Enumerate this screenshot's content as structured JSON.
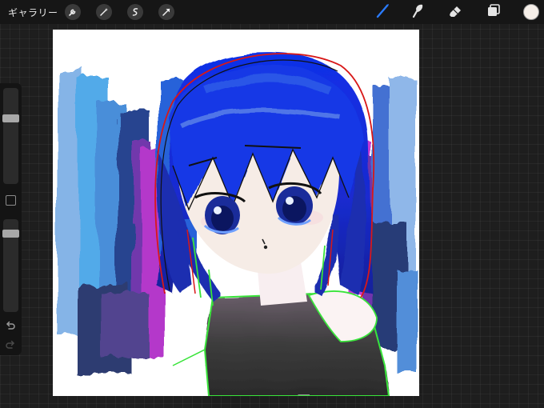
{
  "toolbar": {
    "gallery_label": "ギャラリー",
    "left_tools": [
      "wrench-icon",
      "magic-wand-icon",
      "selection-icon",
      "transform-arrow-icon"
    ],
    "right_tools": [
      "brush-icon",
      "smudge-icon",
      "eraser-icon",
      "layers-icon"
    ],
    "active_tool": "brush",
    "accent_color": "#2a7bff",
    "current_color": "#f6efe9"
  },
  "sidebar": {
    "brush_size": 0.7,
    "opacity": 0.88,
    "icons": [
      "modify-square-icon",
      "undo-icon",
      "redo-icon"
    ]
  },
  "canvas": {
    "background": "#ffffff",
    "content": "painting"
  }
}
